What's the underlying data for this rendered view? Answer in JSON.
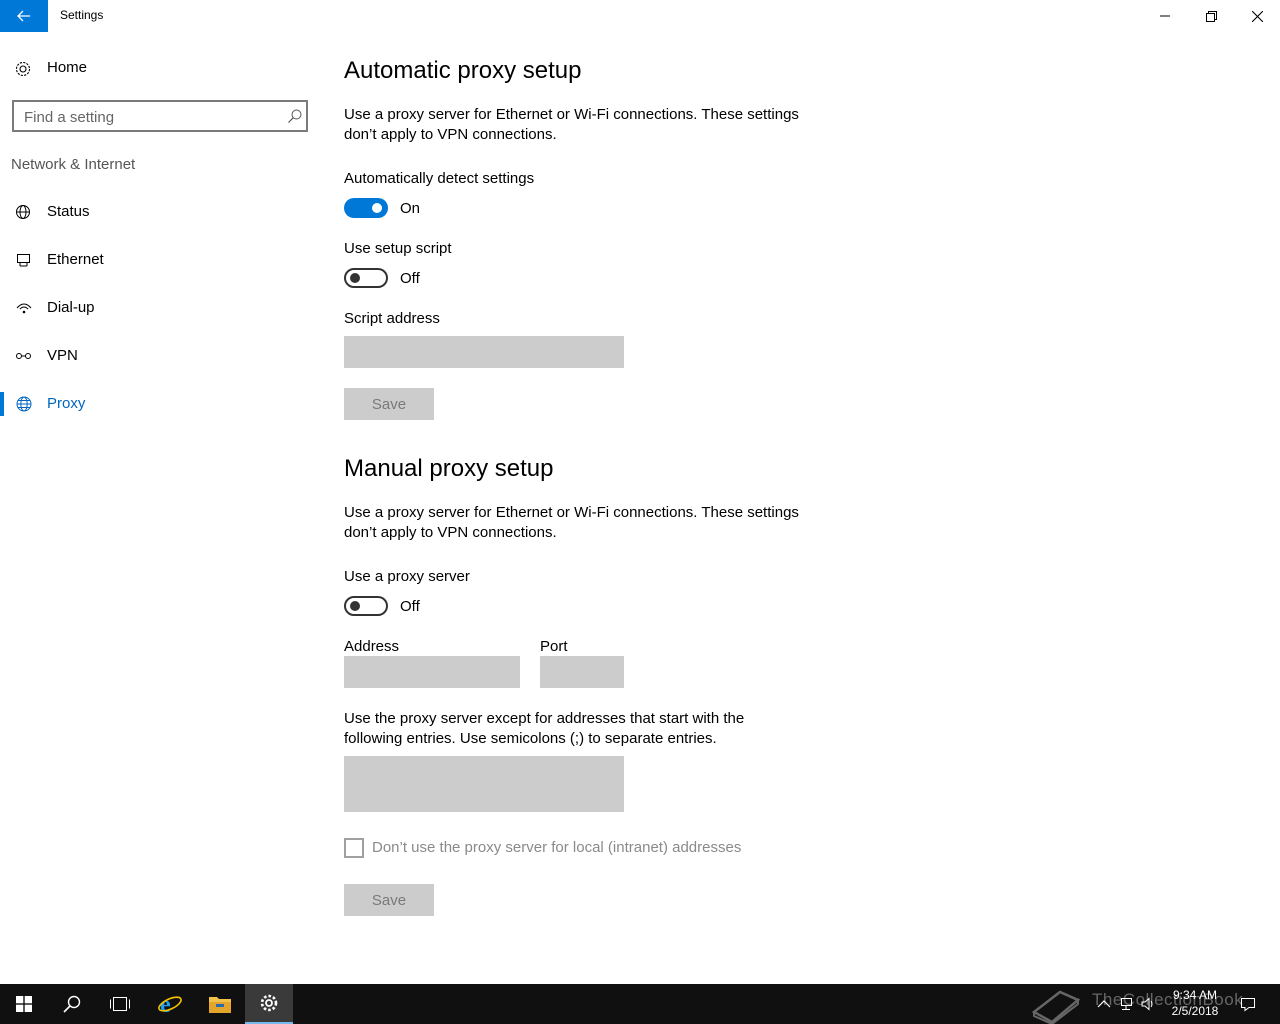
{
  "window": {
    "title": "Settings"
  },
  "sidebar": {
    "home_label": "Home",
    "search_placeholder": "Find a setting",
    "section_title": "Network & Internet",
    "items": [
      {
        "label": "Status",
        "icon": "globe-status-icon"
      },
      {
        "label": "Ethernet",
        "icon": "ethernet-icon"
      },
      {
        "label": "Dial-up",
        "icon": "dialup-icon"
      },
      {
        "label": "VPN",
        "icon": "vpn-icon"
      },
      {
        "label": "Proxy",
        "icon": "globe-icon",
        "active": true
      }
    ]
  },
  "automatic": {
    "title": "Automatic proxy setup",
    "description": "Use a proxy server for Ethernet or Wi-Fi connections. These settings don’t apply to VPN connections.",
    "detect_label": "Automatically detect settings",
    "detect_state": "On",
    "script_label": "Use setup script",
    "script_state": "Off",
    "script_address_label": "Script address",
    "script_address_value": "",
    "save_label": "Save"
  },
  "manual": {
    "title": "Manual proxy setup",
    "description": "Use a proxy server for Ethernet or Wi-Fi connections. These settings don’t apply to VPN connections.",
    "use_proxy_label": "Use a proxy server",
    "use_proxy_state": "Off",
    "address_label": "Address",
    "address_value": "",
    "port_label": "Port",
    "port_value": "",
    "exceptions_description": "Use the proxy server except for addresses that start with the following entries. Use semicolons (;) to separate entries.",
    "exceptions_value": "",
    "local_checkbox_label": "Don’t use the proxy server for local (intranet) addresses",
    "local_checkbox_checked": false,
    "save_label": "Save"
  },
  "taskbar": {
    "watermark": "TheCollectionBook",
    "time": "9:34 AM",
    "date": "2/5/2018"
  },
  "colors": {
    "accent": "#0078d7",
    "taskbar": "#101010",
    "disabled_field": "#cccccc"
  }
}
